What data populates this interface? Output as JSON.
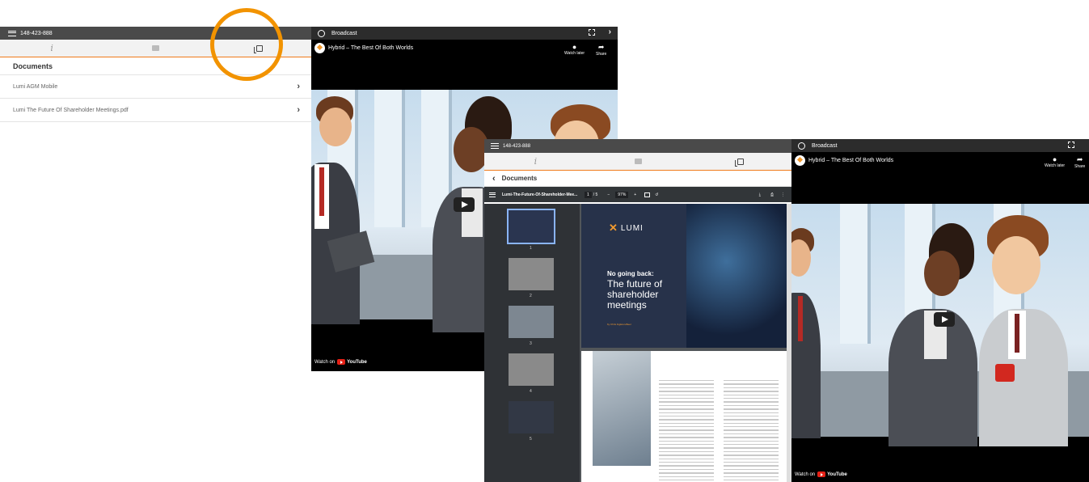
{
  "app_left": {
    "meeting_id": "148-423-888",
    "section_title": "Documents",
    "documents": [
      {
        "name": "Lumi AGM Mobile"
      },
      {
        "name": "Lumi The Future Of Shareholder Meetings.pdf"
      }
    ]
  },
  "broadcast": {
    "header": "Broadcast",
    "video_title": "Hybrid – The Best Of Both Worlds",
    "watch_later": "Watch later",
    "share": "Share",
    "watch_on": "Watch on",
    "youtube": "YouTube"
  },
  "app_right": {
    "meeting_id": "148-423-888",
    "back_title": "Documents",
    "pdf": {
      "filename": "Lumi-The-Future-Of-Shareholder-Mee...",
      "page": "1",
      "total": "/ 5",
      "zoom": "97%",
      "thumb_labels": [
        "1",
        "2",
        "3",
        "4",
        "5"
      ]
    },
    "cover": {
      "brand": "LUMI",
      "heading": "No going back:",
      "subtitle": "The future of shareholder meetings",
      "author": "by Chris Ingleton-Beer"
    }
  },
  "colors": {
    "accent": "#f07a1a",
    "highlight_circle": "#f29300",
    "dark_bar": "#4a4a4a"
  }
}
